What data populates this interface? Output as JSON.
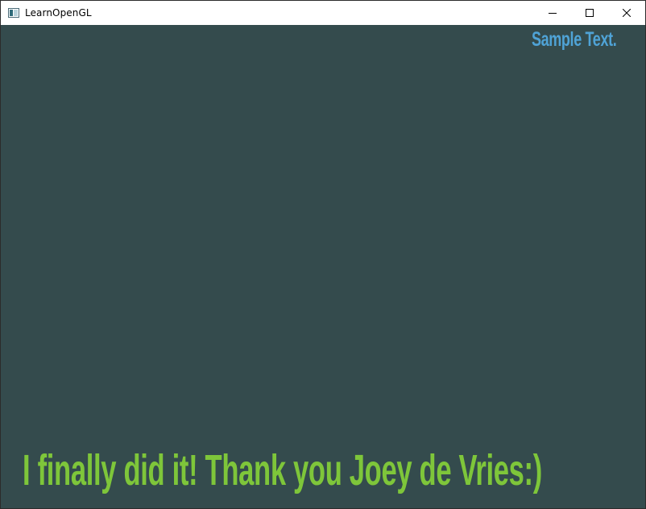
{
  "window": {
    "title": "LearnOpenGL",
    "icon": "app-window-icon",
    "controls": [
      "minimize-icon",
      "maximize-icon",
      "close-icon"
    ]
  },
  "scene": {
    "background_color": "#344b4d",
    "corner_text": "Sample Text.",
    "corner_text_color": "#4fa3d6",
    "main_text": "I finally did it! Thank you Joey de Vries:)",
    "main_text_color": "#7ec63a"
  }
}
